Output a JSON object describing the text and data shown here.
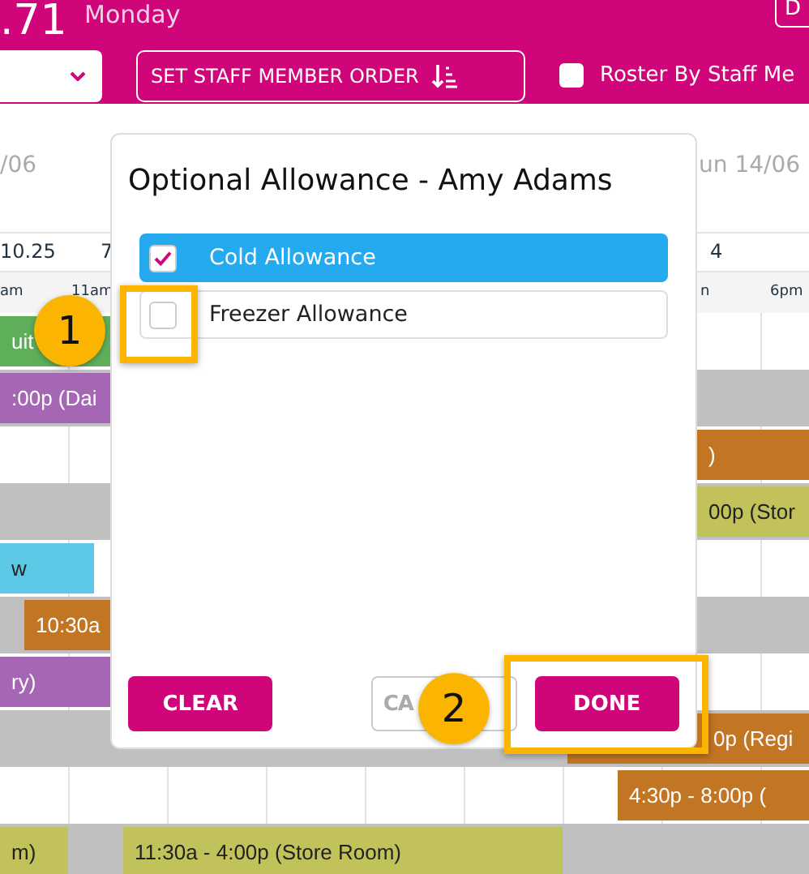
{
  "header": {
    "amount": ".71",
    "day": "Monday",
    "corner_button": "D",
    "order_button": "SET STAFF MEMBER ORDER",
    "roster_checkbox": {
      "label": "Roster By Staff Me",
      "checked": false
    }
  },
  "schedule": {
    "dates": [
      "/06",
      "un 14/06"
    ],
    "columns": [
      "10.25",
      "7",
      "4"
    ],
    "hours": [
      "am",
      "11am",
      "n",
      "6pm"
    ],
    "rows": [
      {
        "shaded": false,
        "shifts": [
          {
            "text": "uit",
            "color": "#5fae5a"
          }
        ]
      },
      {
        "shaded": true,
        "shifts": [
          {
            "text": ":00p (Dai",
            "color": "#a566b3"
          }
        ]
      },
      {
        "shaded": false,
        "shifts": [
          {
            "text": ")",
            "color": "#c27523"
          }
        ]
      },
      {
        "shaded": true,
        "shifts": [
          {
            "text": "00p (Stor",
            "color": "#c1c35a"
          }
        ]
      },
      {
        "shaded": false,
        "shifts": [
          {
            "text": "w",
            "color": "#5bc9e6"
          }
        ]
      },
      {
        "shaded": true,
        "shifts": [
          {
            "text": "10:30a",
            "color": "#c27523"
          }
        ]
      },
      {
        "shaded": false,
        "shifts": [
          {
            "text": "ry)",
            "color": "#a566b3"
          }
        ]
      },
      {
        "shaded": true,
        "shifts": [
          {
            "text": "0p (Regi",
            "color": "#c27523"
          }
        ]
      },
      {
        "shaded": false,
        "shifts": [
          {
            "text": "4:30p - 8:00p (",
            "color": "#c27523"
          }
        ]
      },
      {
        "shaded": true,
        "shifts": [
          {
            "text": "m)",
            "color": "#c1c35a"
          },
          {
            "text": "11:30a - 4:00p (Store Room)",
            "color": "#c1c35a"
          }
        ]
      }
    ]
  },
  "dialog": {
    "title": "Optional Allowance - Amy Adams",
    "options": [
      {
        "label": "Cold Allowance",
        "checked": true
      },
      {
        "label": "Freezer Allowance",
        "checked": false
      }
    ],
    "buttons": [
      {
        "label": "CLEAR",
        "kind": "primary"
      },
      {
        "label": "CA",
        "kind": "outline"
      },
      {
        "label": "DONE",
        "kind": "primary"
      }
    ]
  },
  "callouts": [
    {
      "number": "1"
    },
    {
      "number": "2"
    }
  ]
}
